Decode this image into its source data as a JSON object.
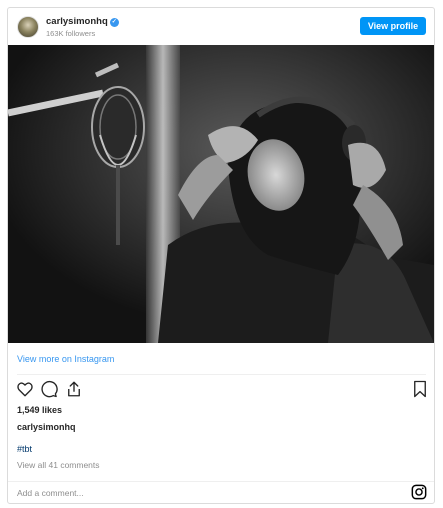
{
  "header": {
    "username": "carlysimonhq",
    "verified_mark": "✓",
    "followers": "163K followers",
    "view_profile_label": "View profile"
  },
  "post": {
    "image_description_icon": "photo",
    "view_more_label": "View more on Instagram",
    "likes": "1,549 likes",
    "caption_username": "carlysimonhq",
    "hashtag": "#tbt",
    "view_comments": "View all 41 comments"
  },
  "comment_box": {
    "placeholder": "Add a comment..."
  },
  "icons": [
    "heart-icon",
    "comment-icon",
    "share-icon",
    "bookmark-icon",
    "instagram-icon"
  ],
  "colors": {
    "accent": "#0095f6",
    "link": "#3897f0",
    "hashtag": "#00376b",
    "muted": "#8e8e8e",
    "text": "#262626"
  }
}
